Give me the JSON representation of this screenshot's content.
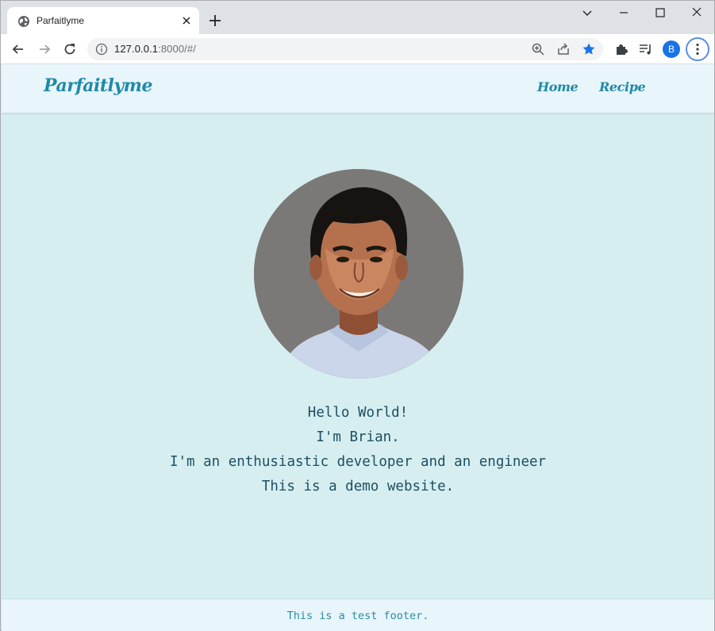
{
  "browser": {
    "tab_title": "Parfaitlyme",
    "url_host": "127.0.0.1",
    "url_path": ":8000/#/",
    "profile_initial": "B"
  },
  "site": {
    "brand": "Parfaitlyme",
    "nav": [
      {
        "label": "Home"
      },
      {
        "label": "Recipe"
      }
    ],
    "intro_lines": [
      "Hello World!",
      "I'm Brian.",
      "I'm an enthusiastic developer and an engineer",
      "This is a demo website."
    ],
    "footer": "This is a test footer."
  },
  "colors": {
    "page_bg": "#d6eef0",
    "header_bg": "#e8f5fa",
    "brand": "#1f8aa8",
    "text": "#1d4f63"
  }
}
